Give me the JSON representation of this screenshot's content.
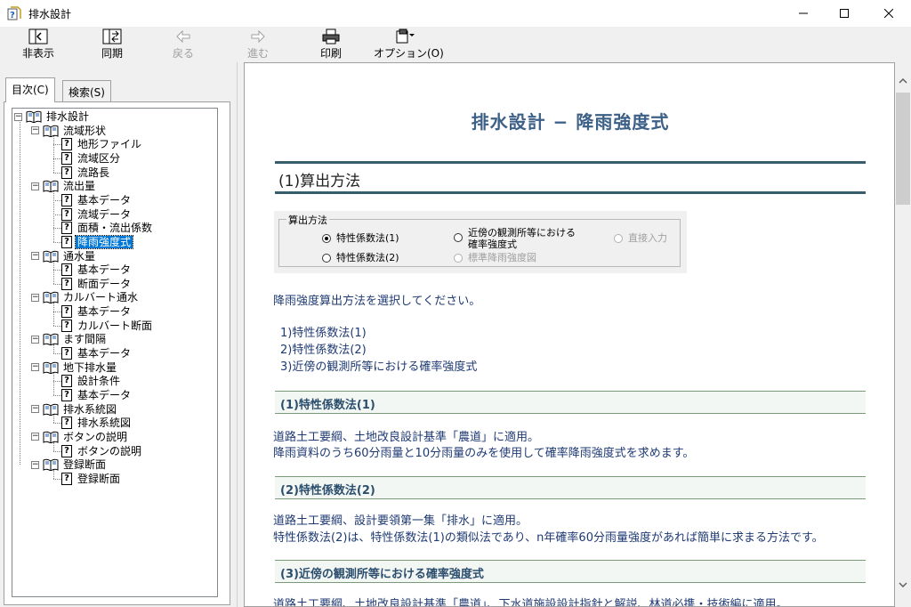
{
  "window": {
    "title": "排水設計"
  },
  "toolbar": {
    "hide": "非表示",
    "sync": "同期",
    "back": "戻る",
    "forward": "進む",
    "print": "印刷",
    "options": "オプション(O)"
  },
  "tabs": {
    "contents": "目次(C)",
    "search": "検索(S)"
  },
  "tree": [
    {
      "label": "排水設計",
      "type": "book",
      "level": 0
    },
    {
      "label": "流域形状",
      "type": "book",
      "level": 1
    },
    {
      "label": "地形ファイル",
      "type": "page",
      "level": 2
    },
    {
      "label": "流域区分",
      "type": "page",
      "level": 2
    },
    {
      "label": "流路長",
      "type": "page",
      "level": 2
    },
    {
      "label": "流出量",
      "type": "book",
      "level": 1
    },
    {
      "label": "基本データ",
      "type": "page",
      "level": 2
    },
    {
      "label": "流域データ",
      "type": "page",
      "level": 2
    },
    {
      "label": "面積・流出係数",
      "type": "page",
      "level": 2
    },
    {
      "label": "降雨強度式",
      "type": "page",
      "level": 2,
      "selected": true
    },
    {
      "label": "通水量",
      "type": "book",
      "level": 1
    },
    {
      "label": "基本データ",
      "type": "page",
      "level": 2
    },
    {
      "label": "断面データ",
      "type": "page",
      "level": 2
    },
    {
      "label": "カルバート通水",
      "type": "book",
      "level": 1
    },
    {
      "label": "基本データ",
      "type": "page",
      "level": 2
    },
    {
      "label": "カルバート断面",
      "type": "page",
      "level": 2
    },
    {
      "label": "ます間隔",
      "type": "book",
      "level": 1
    },
    {
      "label": "基本データ",
      "type": "page",
      "level": 2
    },
    {
      "label": "地下排水量",
      "type": "book",
      "level": 1
    },
    {
      "label": "設計条件",
      "type": "page",
      "level": 2
    },
    {
      "label": "基本データ",
      "type": "page",
      "level": 2
    },
    {
      "label": "排水系統図",
      "type": "book",
      "level": 1
    },
    {
      "label": "排水系統図",
      "type": "page",
      "level": 2
    },
    {
      "label": "ボタンの説明",
      "type": "book",
      "level": 1
    },
    {
      "label": "ボタンの説明",
      "type": "page",
      "level": 2
    },
    {
      "label": "登録断面",
      "type": "book",
      "level": 1
    },
    {
      "label": "登録断面",
      "type": "page",
      "level": 2
    }
  ],
  "content": {
    "title": "排水設計 − 降雨強度式",
    "heading": "(1)算出方法",
    "calc": {
      "legend": "算出方法",
      "opt1": "特性係数法(1)",
      "opt2": "特性係数法(2)",
      "opt3_line1": "近傍の観測所等における",
      "opt3_line2": "確率強度式",
      "opt4": "標準降雨強度図",
      "opt5": "直接入力"
    },
    "instruction": "降雨強度算出方法を選択してください。",
    "list": [
      "1)特性係数法(1)",
      "2)特性係数法(2)",
      "3)近傍の観測所等における確率強度式"
    ],
    "sec1": {
      "title": "(1)特性係数法(1)",
      "line1": "道路土工要綱、土地改良設計基準「農道」に適用。",
      "line2": "降雨資料のうち60分雨量と10分雨量のみを使用して確率降雨強度式を求めます。"
    },
    "sec2": {
      "title": "(2)特性係数法(2)",
      "line1": "道路土工要綱、設計要領第一集「排水」に適用。",
      "line2": "特性係数法(2)は、特性係数法(1)の類似法であり、n年確率60分雨量強度があれば簡単に求まる方法です。"
    },
    "sec3": {
      "title": "(3)近傍の観測所等における確率強度式",
      "line1": "道路土工要綱、土地改良設計基準「農道」、下水道施設設計指針と解説、林道必携・技術編に適用。"
    }
  }
}
